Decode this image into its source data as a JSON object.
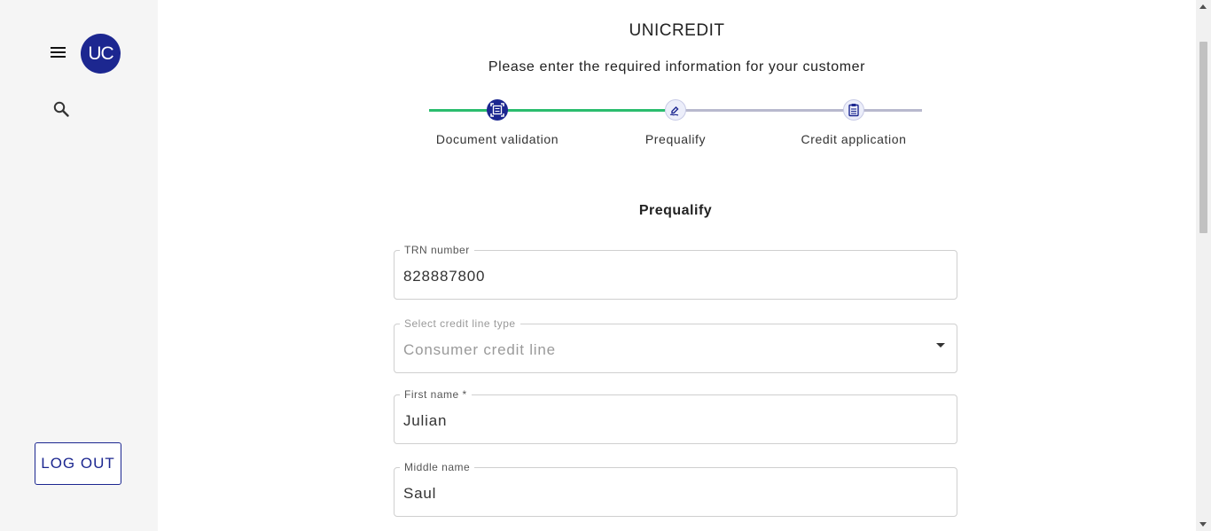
{
  "sidebar": {
    "avatar_initials": "UC",
    "menu_icon": "hamburger-menu-icon",
    "search_icon": "search-icon",
    "logout_label": "LOG OUT"
  },
  "header": {
    "title": "UNICREDIT",
    "subtitle": "Please enter the required information for your customer"
  },
  "stepper": {
    "steps": [
      {
        "label": "Document validation",
        "icon": "document-scan-icon",
        "state": "completed"
      },
      {
        "label": "Prequalify",
        "icon": "signature-icon",
        "state": "current"
      },
      {
        "label": "Credit application",
        "icon": "clipboard-icon",
        "state": "pending"
      }
    ]
  },
  "form": {
    "section_title": "Prequalify",
    "trn": {
      "label": "TRN number",
      "value": "828887800"
    },
    "credit_line_type": {
      "label": "Select credit line type",
      "value": "Consumer credit line"
    },
    "first_name": {
      "label": "First name *",
      "value": "Julian"
    },
    "middle_name": {
      "label": "Middle name",
      "value": "Saul"
    }
  },
  "colors": {
    "brand": "#1c2790",
    "progress_done": "#2bbd6e",
    "progress_pending": "#b8b9ce",
    "sidebar_bg": "#f5f5f5"
  }
}
